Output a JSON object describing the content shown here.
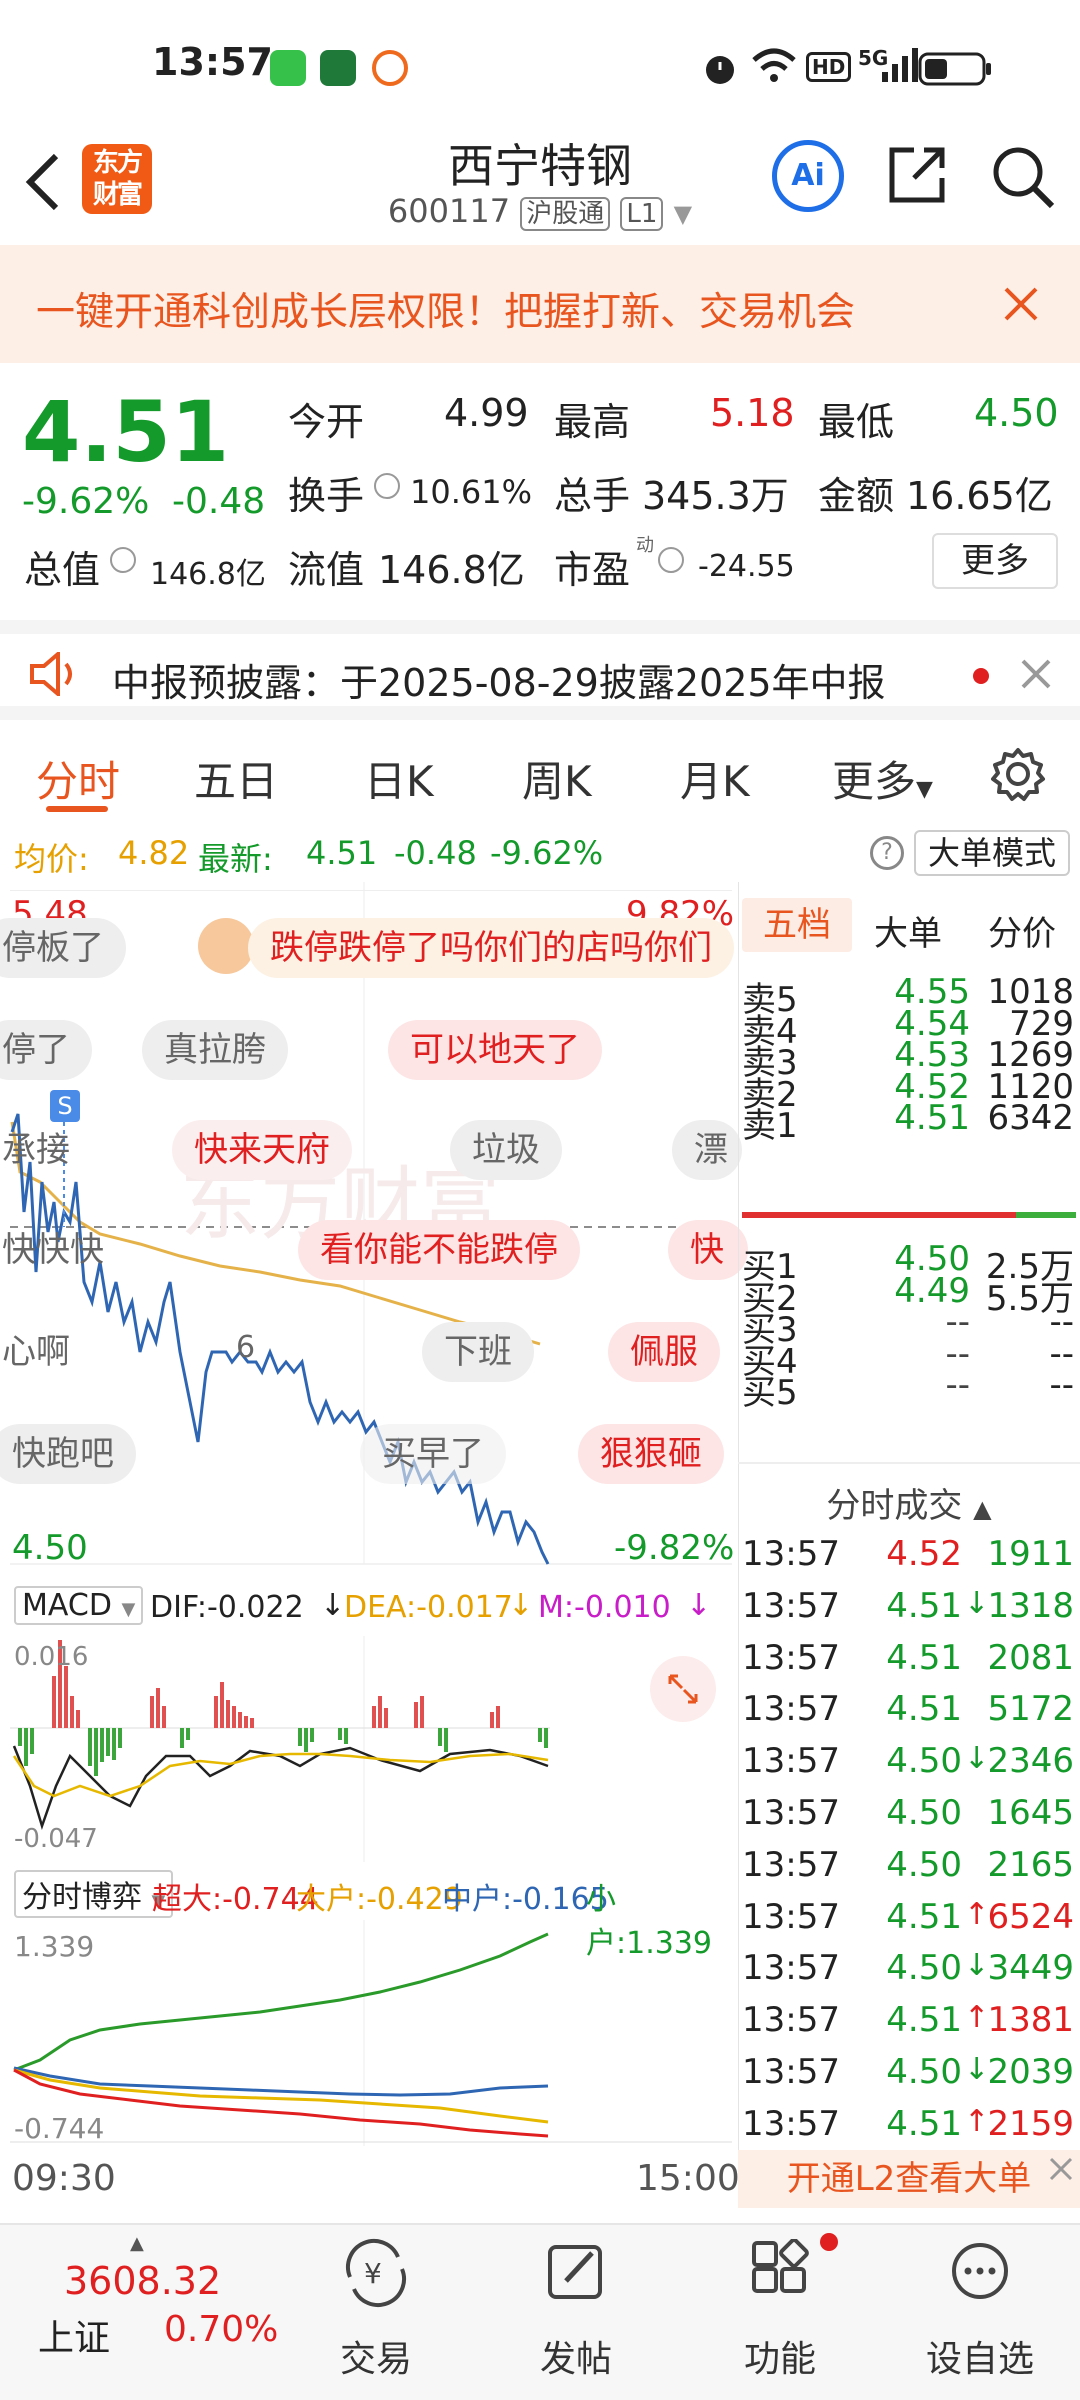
{
  "status": {
    "time": "13:57",
    "hd": "HD",
    "sig": "5G"
  },
  "header": {
    "logo": "东方财富",
    "title": "西宁特钢",
    "code": "600117",
    "tag1": "沪股通",
    "tag2": "L1",
    "ai": "Ai"
  },
  "banner": {
    "text": "一键开通科创成长层权限！把握打新、交易机会"
  },
  "quote": {
    "price": "4.51",
    "pct": "-9.62%",
    "chg": "-0.48",
    "open_label": "今开",
    "open": "4.99",
    "high_label": "最高",
    "high": "5.18",
    "low_label": "最低",
    "low": "4.50",
    "turnover_label": "换手",
    "turnover": "10.61%",
    "vol_label": "总手",
    "vol": "345.3万",
    "amount_label": "金额",
    "amount": "16.65亿",
    "mcap_label": "总值",
    "mcap": "146.8亿",
    "float_label": "流值",
    "float": "146.8亿",
    "pe_label": "市盈",
    "pe_sup": "动",
    "pe": "-24.55",
    "more": "更多"
  },
  "notice": {
    "text": "中报预披露：于2025-08-29披露2025年中报"
  },
  "tabs": [
    "分时",
    "五日",
    "日K",
    "周K",
    "月K",
    "更多"
  ],
  "avg": {
    "avg_label": "均价:",
    "avg": "4.82",
    "last_label": "最新:",
    "last": "4.51",
    "chg": "-0.48",
    "pct": "-9.62%",
    "mode": "大单模式"
  },
  "chart": {
    "ymax": "5.48",
    "ymax_pct": "9.82%",
    "ymin": "4.50",
    "ymin_pct": "-9.82%",
    "t_start": "09:30",
    "t_end": "15:00",
    "marker": "S",
    "watermark": "东方财富",
    "macd_num": "6"
  },
  "danmu": [
    "停板了",
    "跌停跌停了吗你们的店吗你们",
    "停了",
    "真拉胯",
    "可以地天了",
    "承接",
    "快来天府",
    "垃圾",
    "漂",
    "快快快",
    "看你能不能跌停",
    "快",
    "心啊",
    "下班",
    "佩服",
    "快跑吧",
    "买早了",
    "狠狠砸"
  ],
  "macd": {
    "label": "MACD",
    "dif": "DIF:-0.022",
    "dea": "DEA:-0.017",
    "m": "M:-0.010",
    "top": "0.016",
    "bottom": "-0.047"
  },
  "bo": {
    "label": "分时博弈",
    "super": "超大:-0.744",
    "large": "大户:-0.429",
    "mid": "中户:-0.165",
    "small": "小户:1.339",
    "top": "1.339",
    "bottom": "-0.744"
  },
  "orderbook": {
    "tabs": [
      "五档",
      "大单",
      "分价"
    ],
    "asks": [
      {
        "label": "卖5",
        "price": "4.55",
        "vol": "1018"
      },
      {
        "label": "卖4",
        "price": "4.54",
        "vol": "729"
      },
      {
        "label": "卖3",
        "price": "4.53",
        "vol": "1269"
      },
      {
        "label": "卖2",
        "price": "4.52",
        "vol": "1120"
      },
      {
        "label": "卖1",
        "price": "4.51",
        "vol": "6342"
      }
    ],
    "bids": [
      {
        "label": "买1",
        "price": "4.50",
        "vol": "2.5万"
      },
      {
        "label": "买2",
        "price": "4.49",
        "vol": "5.5万"
      },
      {
        "label": "买3",
        "price": "--",
        "vol": "--"
      },
      {
        "label": "买4",
        "price": "--",
        "vol": "--"
      },
      {
        "label": "买5",
        "price": "--",
        "vol": "--"
      }
    ],
    "ticks_title": "分时成交",
    "ticks": [
      {
        "t": "13:57",
        "p": "4.52",
        "v": "1911",
        "dir": ""
      },
      {
        "t": "13:57",
        "p": "4.51",
        "v": "1318",
        "dir": "↓"
      },
      {
        "t": "13:57",
        "p": "4.51",
        "v": "2081",
        "dir": ""
      },
      {
        "t": "13:57",
        "p": "4.51",
        "v": "5172",
        "dir": ""
      },
      {
        "t": "13:57",
        "p": "4.50",
        "v": "2346",
        "dir": "↓"
      },
      {
        "t": "13:57",
        "p": "4.50",
        "v": "1645",
        "dir": ""
      },
      {
        "t": "13:57",
        "p": "4.50",
        "v": "2165",
        "dir": ""
      },
      {
        "t": "13:57",
        "p": "4.51",
        "v": "6524",
        "dir": "↑"
      },
      {
        "t": "13:57",
        "p": "4.50",
        "v": "3449",
        "dir": "↓"
      },
      {
        "t": "13:57",
        "p": "4.51",
        "v": "1381",
        "dir": "↑"
      },
      {
        "t": "13:57",
        "p": "4.50",
        "v": "2039",
        "dir": "↓"
      },
      {
        "t": "13:57",
        "p": "4.51",
        "v": "2159",
        "dir": "↑"
      }
    ],
    "l2": "开通L2查看大单"
  },
  "bottomnav": {
    "index_value": "3608.32",
    "index_name": "上证",
    "index_pct": "0.70%",
    "items": [
      "交易",
      "发帖",
      "功能",
      "设自选"
    ]
  }
}
